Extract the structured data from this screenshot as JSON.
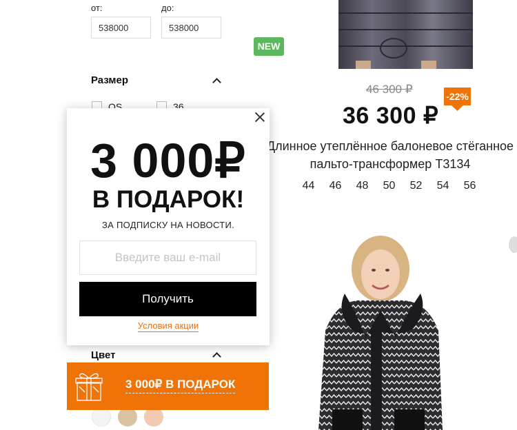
{
  "filter": {
    "price": {
      "from_label": "от:",
      "to_label": "до:",
      "from_value": "538000",
      "to_value": "538000"
    },
    "size": {
      "title": "Размер",
      "options": [
        "OS",
        "36"
      ]
    },
    "color": {
      "title": "Цвет",
      "swatches": [
        "#f4f4f4",
        "#d9c3a5",
        "#f2c9b2"
      ]
    }
  },
  "product1": {
    "badge": "NEW",
    "old_price": "46 300 ₽",
    "discount": "-22%",
    "price": "36 300 ₽",
    "title": "Длинное утеплённое балоневое стёганное пальто-трансформер Т3134",
    "sizes": [
      "44",
      "46",
      "48",
      "50",
      "52",
      "54",
      "56"
    ]
  },
  "popup": {
    "amount": "3 000₽",
    "headline": "В ПОДАРОК!",
    "subtitle": "ЗА ПОДПИСКУ НА НОВОСТИ.",
    "email_placeholder": "Введите ваш e-mail",
    "button": "Получить",
    "terms_link": "Условия акции"
  },
  "gift_bar": {
    "text": "3 000₽ В ПОДАРОК"
  },
  "colors": {
    "accent_orange": "#ef7306",
    "new_badge_green": "#5cb85c",
    "button_black": "#000000"
  }
}
